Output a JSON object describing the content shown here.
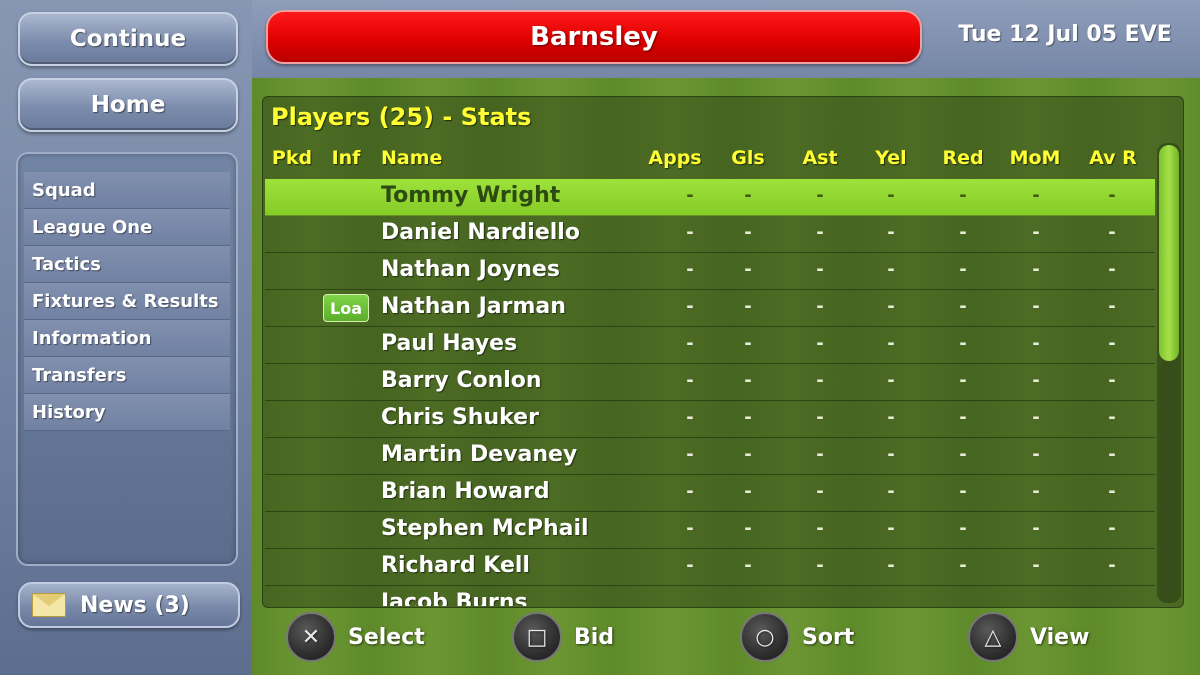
{
  "header": {
    "club_name": "Barnsley",
    "date": "Tue 12 Jul 05 EVE",
    "accent_color": "#e00000"
  },
  "left_nav": {
    "continue_label": "Continue",
    "home_label": "Home",
    "items": [
      {
        "label": "Squad"
      },
      {
        "label": "League One"
      },
      {
        "label": "Tactics"
      },
      {
        "label": "Fixtures & Results"
      },
      {
        "label": "Information"
      },
      {
        "label": "Transfers"
      },
      {
        "label": "History"
      }
    ],
    "news_label": "News (3)",
    "news_icon": "envelope-icon"
  },
  "table": {
    "title": "Players (25) - Stats",
    "columns": {
      "pkd": "Pkd",
      "inf": "Inf",
      "name": "Name",
      "apps": "Apps",
      "gls": "Gls",
      "ast": "Ast",
      "yel": "Yel",
      "red": "Red",
      "mom": "MoM",
      "avr": "Av R"
    },
    "selected_index": 0,
    "rows": [
      {
        "name": "Tommy Wright",
        "inf": "",
        "apps": "-",
        "gls": "-",
        "ast": "-",
        "yel": "-",
        "red": "-",
        "mom": "-",
        "avr": "-"
      },
      {
        "name": "Daniel Nardiello",
        "inf": "",
        "apps": "-",
        "gls": "-",
        "ast": "-",
        "yel": "-",
        "red": "-",
        "mom": "-",
        "avr": "-"
      },
      {
        "name": "Nathan Joynes",
        "inf": "",
        "apps": "-",
        "gls": "-",
        "ast": "-",
        "yel": "-",
        "red": "-",
        "mom": "-",
        "avr": "-"
      },
      {
        "name": "Nathan Jarman",
        "inf": "Loa",
        "apps": "-",
        "gls": "-",
        "ast": "-",
        "yel": "-",
        "red": "-",
        "mom": "-",
        "avr": "-"
      },
      {
        "name": "Paul Hayes",
        "inf": "",
        "apps": "-",
        "gls": "-",
        "ast": "-",
        "yel": "-",
        "red": "-",
        "mom": "-",
        "avr": "-"
      },
      {
        "name": "Barry Conlon",
        "inf": "",
        "apps": "-",
        "gls": "-",
        "ast": "-",
        "yel": "-",
        "red": "-",
        "mom": "-",
        "avr": "-"
      },
      {
        "name": "Chris Shuker",
        "inf": "",
        "apps": "-",
        "gls": "-",
        "ast": "-",
        "yel": "-",
        "red": "-",
        "mom": "-",
        "avr": "-"
      },
      {
        "name": "Martin Devaney",
        "inf": "",
        "apps": "-",
        "gls": "-",
        "ast": "-",
        "yel": "-",
        "red": "-",
        "mom": "-",
        "avr": "-"
      },
      {
        "name": "Brian Howard",
        "inf": "",
        "apps": "-",
        "gls": "-",
        "ast": "-",
        "yel": "-",
        "red": "-",
        "mom": "-",
        "avr": "-"
      },
      {
        "name": "Stephen McPhail",
        "inf": "",
        "apps": "-",
        "gls": "-",
        "ast": "-",
        "yel": "-",
        "red": "-",
        "mom": "-",
        "avr": "-"
      },
      {
        "name": "Richard Kell",
        "inf": "",
        "apps": "-",
        "gls": "-",
        "ast": "-",
        "yel": "-",
        "red": "-",
        "mom": "-",
        "avr": "-"
      },
      {
        "name": "Jacob Burns",
        "inf": "",
        "apps": "",
        "gls": "",
        "ast": "",
        "yel": "",
        "red": "",
        "mom": "",
        "avr": "",
        "partial": true
      }
    ]
  },
  "footer": {
    "controls": [
      {
        "symbol": "✕",
        "icon": "cross-button-icon",
        "label": "Select"
      },
      {
        "symbol": "□",
        "icon": "square-button-icon",
        "label": "Bid"
      },
      {
        "symbol": "○",
        "icon": "circle-button-icon",
        "label": "Sort"
      },
      {
        "symbol": "△",
        "icon": "triangle-button-icon",
        "label": "View"
      }
    ]
  }
}
